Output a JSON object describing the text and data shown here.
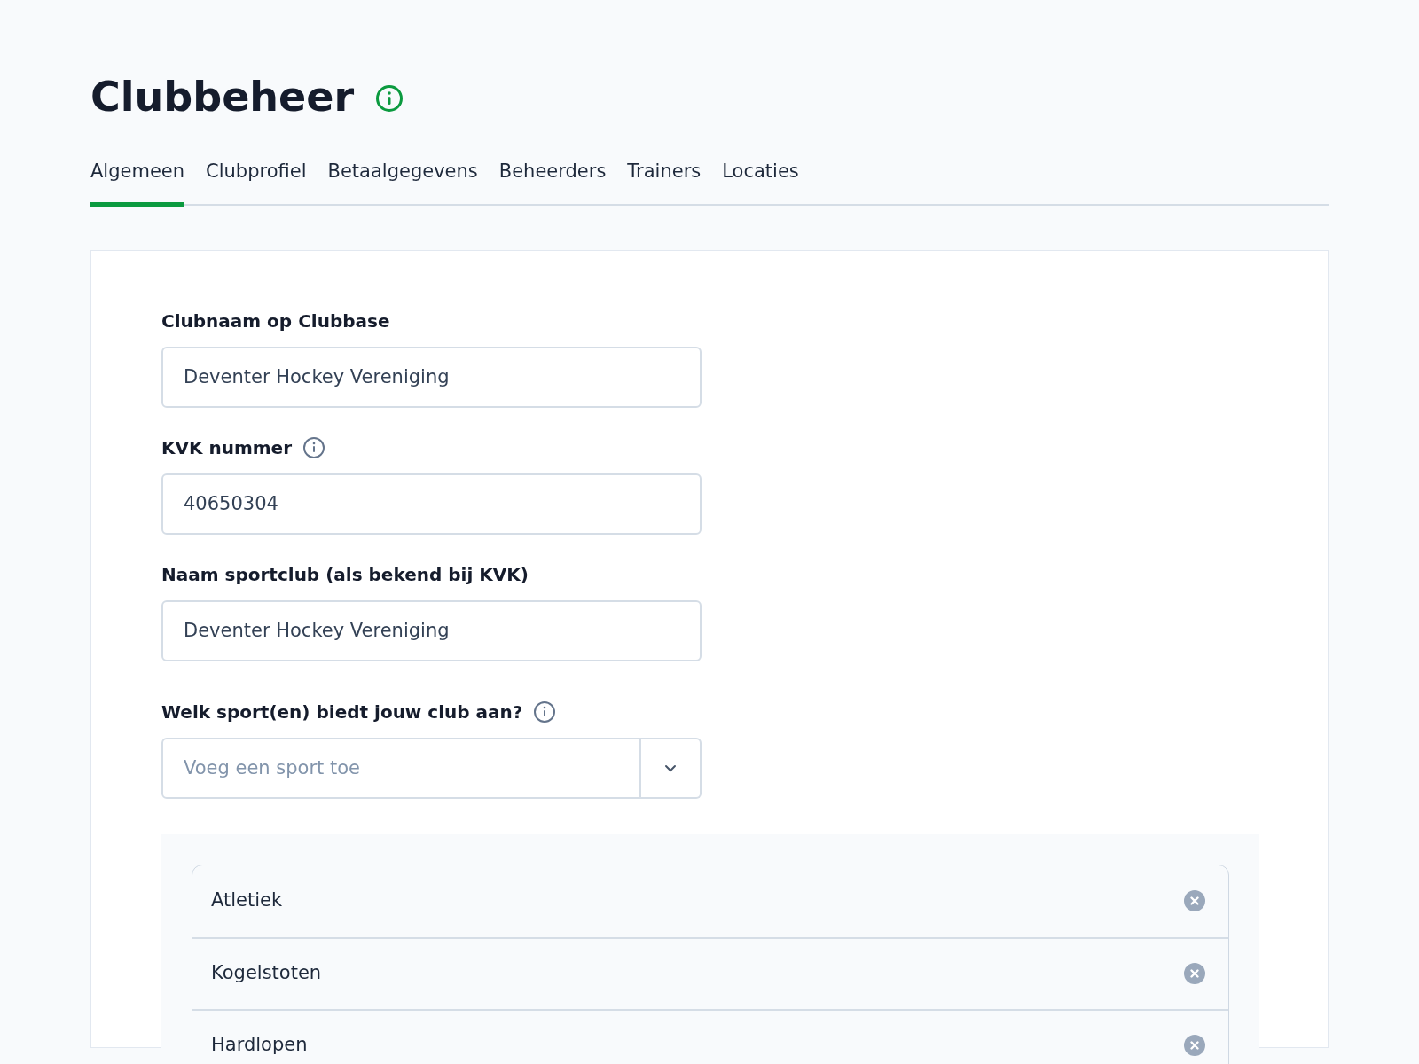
{
  "page": {
    "title": "Clubbeheer"
  },
  "tabs": [
    {
      "label": "Algemeen",
      "selected": true
    },
    {
      "label": "Clubprofiel",
      "selected": false
    },
    {
      "label": "Betaalgegevens",
      "selected": false
    },
    {
      "label": "Beheerders",
      "selected": false
    },
    {
      "label": "Trainers",
      "selected": false
    },
    {
      "label": "Locaties",
      "selected": false
    }
  ],
  "fields": [
    {
      "kind": "text",
      "label": "Clubnaam op Clubbase",
      "info": false,
      "value": "Deventer Hockey Vereniging"
    },
    {
      "kind": "text",
      "label": "KVK nummer",
      "info": true,
      "value": "40650304"
    },
    {
      "kind": "text",
      "label": "Naam sportclub (als bekend bij KVK)",
      "info": false,
      "value": "Deventer Hockey Vereniging"
    },
    {
      "kind": "select",
      "label": "Welk sport(en) biedt jouw club aan?",
      "info": true,
      "placeholder": "Voeg een sport toe"
    }
  ],
  "sports": [
    {
      "name": "Atletiek"
    },
    {
      "name": "Kogelstoten"
    },
    {
      "name": "Hardlopen"
    }
  ]
}
